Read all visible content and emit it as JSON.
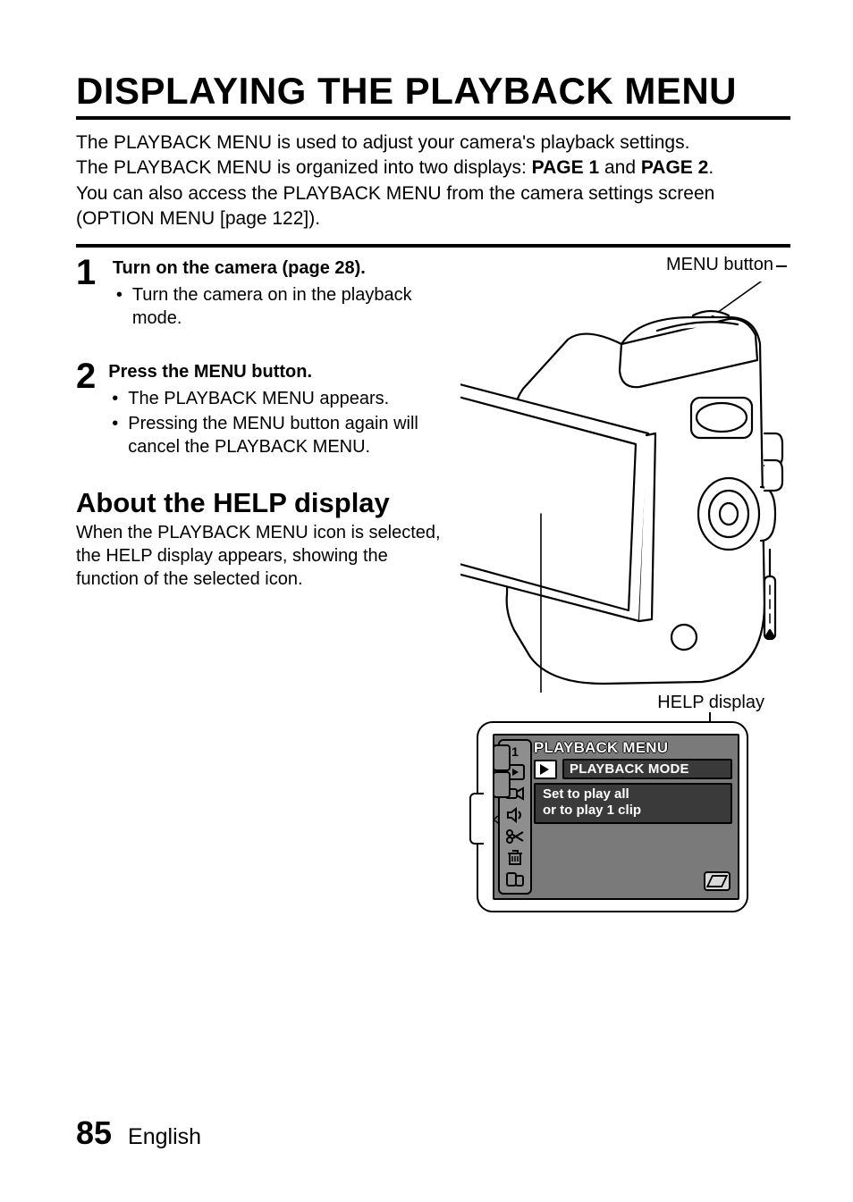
{
  "title": "DISPLAYING THE PLAYBACK MENU",
  "intro": {
    "line1": "The PLAYBACK MENU is used to adjust your camera's playback settings.",
    "line2a": "The PLAYBACK MENU is organized into two displays: ",
    "page1": "PAGE 1",
    "and": " and ",
    "page2": "PAGE 2",
    "line2b": ".",
    "line3": "You can also access the PLAYBACK MENU from the camera settings screen (OPTION MENU [page 122])."
  },
  "steps": [
    {
      "num": "1",
      "heading": "Turn on the camera (page 28).",
      "bullets": [
        "Turn the camera on in the playback mode."
      ]
    },
    {
      "num": "2",
      "heading": "Press the MENU button.",
      "bullets": [
        "The PLAYBACK MENU appears.",
        "Pressing the MENU button again will cancel the PLAYBACK MENU."
      ]
    }
  ],
  "about": {
    "heading": "About the HELP display",
    "text": "When the PLAYBACK MENU icon is selected, the HELP display appears, showing the function of the selected icon."
  },
  "diagram": {
    "menu_button_label": "MENU button",
    "help_display_label": "HELP display",
    "lcd": {
      "title": "PLAYBACK MENU",
      "mode": "PLAYBACK MODE",
      "help_line1": "Set to play all",
      "help_line2": "or to play 1 clip",
      "page_indicator": "1"
    }
  },
  "footer": {
    "page": "85",
    "language": "English"
  }
}
